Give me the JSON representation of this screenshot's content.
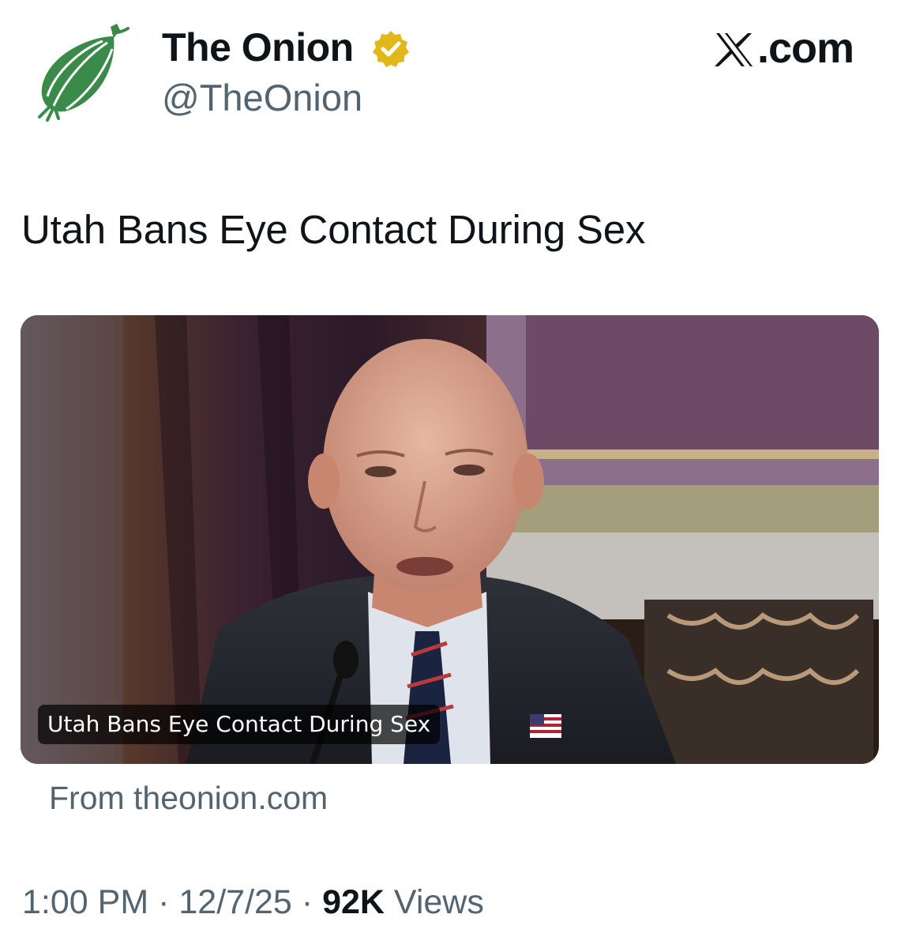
{
  "author": {
    "display_name": "The Onion",
    "handle": "@TheOnion",
    "verified": true,
    "avatar_icon": "onion-logo-icon",
    "brand_color": "#3a8a4a",
    "verified_color": "#e2b719"
  },
  "brand": {
    "site": ".com",
    "icon": "x-logo-icon"
  },
  "post": {
    "text": "Utah Bans Eye Contact During Sex"
  },
  "link_card": {
    "caption": "Utah Bans Eye Contact During Sex",
    "source": "From theonion.com"
  },
  "meta": {
    "time": "1:00 PM",
    "date": "12/7/25",
    "separator": "·",
    "views_count": "92K",
    "views_label": "Views"
  }
}
